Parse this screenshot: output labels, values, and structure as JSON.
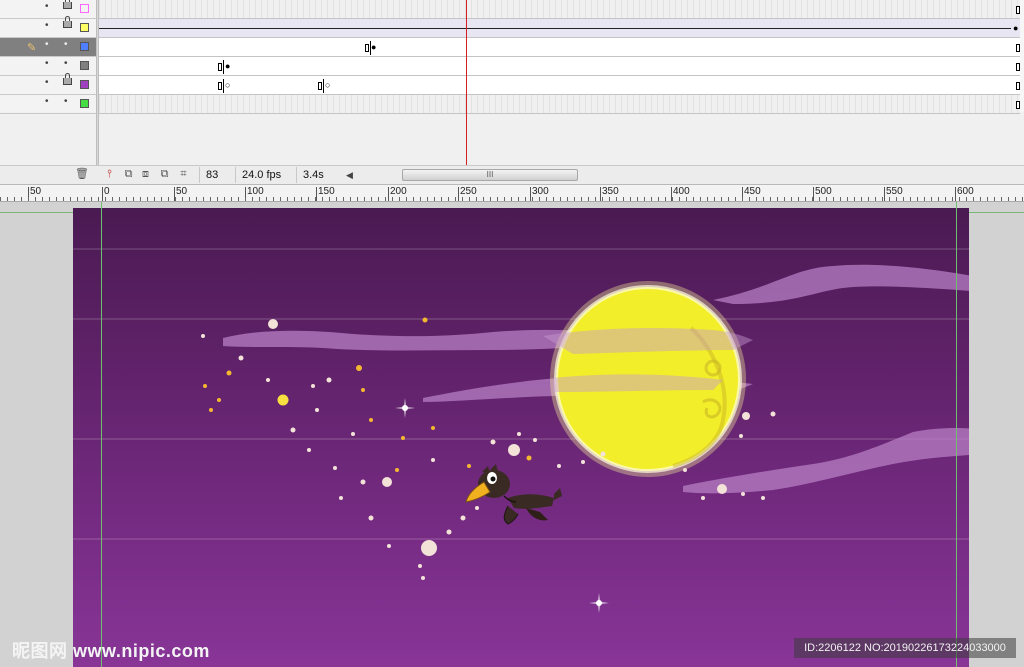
{
  "timeline": {
    "current_frame": "83",
    "frame_rate": "24.0 fps",
    "elapsed_time": "3.4s",
    "scroll_grip": "III",
    "layers": [
      {
        "color": "#ff66ff",
        "locked": true,
        "active": false
      },
      {
        "color": "#ffff66",
        "locked": true,
        "active": false
      },
      {
        "color": "#4f7fff",
        "locked": false,
        "active": true
      },
      {
        "color": "#808080",
        "locked": false,
        "active": false
      },
      {
        "color": "#a040c0",
        "locked": true,
        "active": false
      },
      {
        "color": "#44dd44",
        "locked": false,
        "active": false
      }
    ]
  },
  "ruler": {
    "labels": [
      "50",
      "0",
      "50",
      "100",
      "150",
      "200",
      "250",
      "300",
      "350",
      "400",
      "450",
      "500",
      "550",
      "600"
    ]
  },
  "stage": {
    "background_top": "#4a1a52",
    "background_bottom": "#883597",
    "moon_color": "#f2ee2a",
    "cloud_color": "#b77fc4"
  },
  "watermark": {
    "site": "昵图网 www.nipic.com",
    "id": "ID:2206122 NO:20190226173224033000"
  },
  "icons": {
    "pencil": "pencil-icon",
    "eye": "visibility-dot-icon",
    "lock": "lock-icon",
    "trash": "trash-icon",
    "onion": "onion-skin-icon"
  }
}
